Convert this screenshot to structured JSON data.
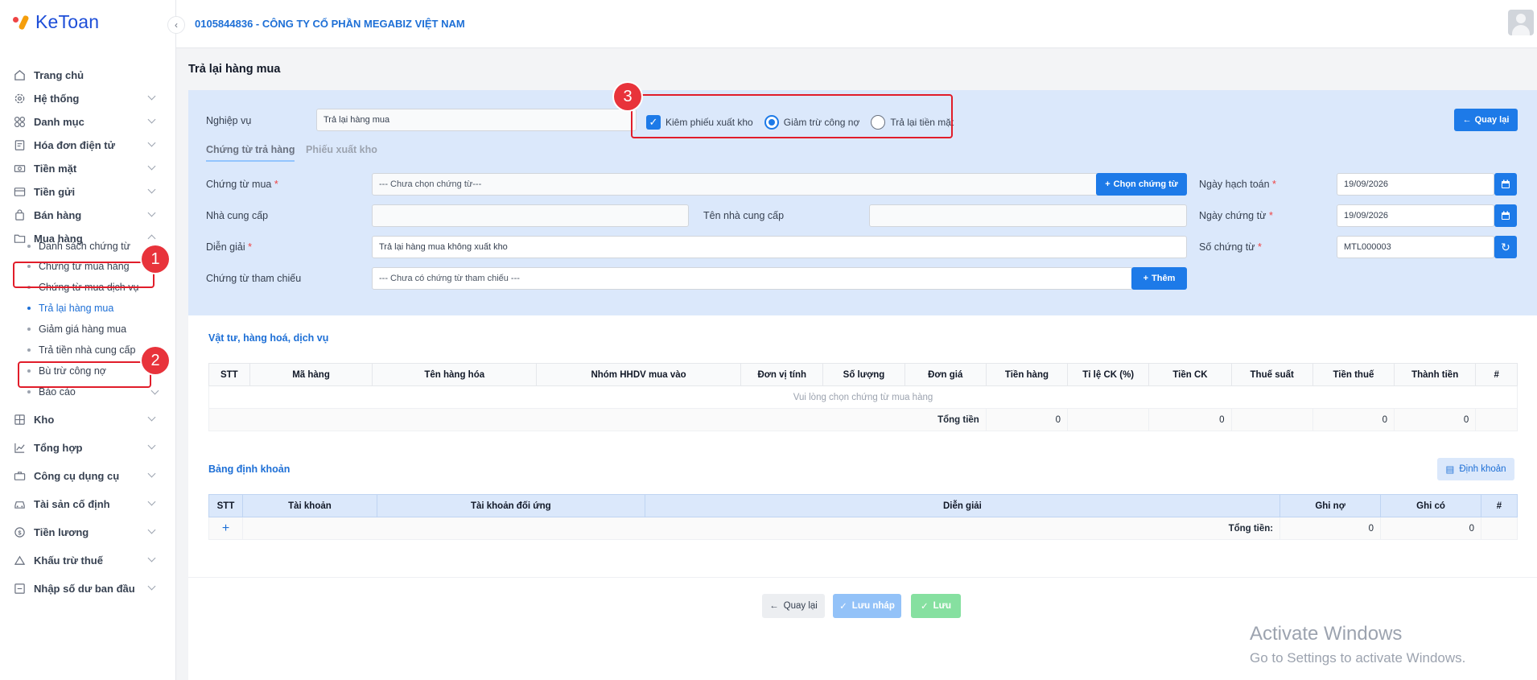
{
  "app": {
    "logo": "KeToan",
    "company": "0105844836 - CÔNG TY CỔ PHẦN MEGABIZ VIỆT NAM"
  },
  "sidebar": {
    "items": [
      {
        "label": "Trang chủ",
        "icon": "home-icon"
      },
      {
        "label": "Hệ thống",
        "icon": "gear-icon"
      },
      {
        "label": "Danh mục",
        "icon": "grid-icon"
      },
      {
        "label": "Hóa đơn điện tử",
        "icon": "invoice-icon"
      },
      {
        "label": "Tiền mặt",
        "icon": "cash-icon"
      },
      {
        "label": "Tiền gửi",
        "icon": "bank-icon"
      },
      {
        "label": "Bán hàng",
        "icon": "sales-icon"
      },
      {
        "label": "Mua hàng",
        "icon": "folder-icon"
      },
      {
        "label": "Kho",
        "icon": "warehouse-icon"
      },
      {
        "label": "Tổng hợp",
        "icon": "chart-icon"
      },
      {
        "label": "Công cụ dụng cụ",
        "icon": "tools-icon"
      },
      {
        "label": "Tài sản cố định",
        "icon": "car-icon"
      },
      {
        "label": "Tiền lương",
        "icon": "dollar-icon"
      },
      {
        "label": "Khấu trừ thuế",
        "icon": "tax-icon"
      },
      {
        "label": "Nhập số dư ban đầu",
        "icon": "import-icon"
      }
    ],
    "sub_items": [
      "Danh sách chứng từ",
      "Chứng từ mua hàng",
      "Chứng từ mua dịch vụ",
      "Trả lại hàng mua",
      "Giảm giá hàng mua",
      "Trả tiền nhà cung cấp",
      "Bù trừ công nợ",
      "Báo cáo"
    ]
  },
  "page": {
    "title": "Trả lại hàng mua"
  },
  "form": {
    "nghiep_vu_label": "Nghiệp vụ",
    "nghiep_vu_value": "Trả lại hàng mua",
    "check_kiem_phieu": "Kiêm phiếu xuất kho",
    "radio_giam_tru": "Giảm trừ công nợ",
    "radio_tra_tien": "Trả lại tiền mặt",
    "back_label": "Quay lại",
    "tabs": [
      "Chứng từ trả hàng",
      "Phiếu xuất kho"
    ],
    "chung_tu_mua_label": "Chứng từ mua",
    "chung_tu_mua_placeholder": "--- Chưa chọn chứng từ---",
    "chon_chung_tu_btn": "Chọn chứng từ",
    "nha_cung_cap_label": "Nhà cung cấp",
    "ten_ncc_label": "Tên nhà cung cấp",
    "dien_giai_label": "Diễn giải",
    "dien_giai_value": "Trả lại hàng mua không xuất kho",
    "tham_chieu_label": "Chứng từ tham chiếu",
    "tham_chieu_placeholder": "--- Chưa có chứng từ tham chiếu ---",
    "them_btn": "Thêm",
    "ngay_hach_toan_label": "Ngày hạch toán",
    "ngay_hach_toan_value": "19/09/2026",
    "ngay_chung_tu_label": "Ngày chứng từ",
    "ngay_chung_tu_value": "19/09/2026",
    "so_chung_tu_label": "Số chứng từ",
    "so_chung_tu_value": "MTL000003",
    "required_mark": "*"
  },
  "goods": {
    "title": "Vật tư, hàng hoá, dịch vụ",
    "columns": [
      "STT",
      "Mã hàng",
      "Tên hàng hóa",
      "Nhóm HHDV mua vào",
      "Đơn vị tính",
      "Số lượng",
      "Đơn giá",
      "Tiền hàng",
      "Tỉ lệ CK (%)",
      "Tiền CK",
      "Thuế suất",
      "Tiền thuế",
      "Thành tiền",
      "#"
    ],
    "empty_message": "Vui lòng chọn chứng từ mua hàng",
    "total_label": "Tổng tiền",
    "totals": {
      "tien_hang": "0",
      "tien_ck": "0",
      "tien_thue": "0",
      "thanh_tien": "0"
    }
  },
  "accounting": {
    "title": "Bảng định khoản",
    "dinh_khoan_btn": "Định khoản",
    "columns": [
      "STT",
      "Tài khoản",
      "Tài khoản đối ứng",
      "Diễn giải",
      "Ghi nợ",
      "Ghi có",
      "#"
    ],
    "add_symbol": "+",
    "total_label": "Tổng tiền:",
    "total_no": "0",
    "total_co": "0"
  },
  "footer": {
    "back": "Quay lại",
    "save_draft": "Lưu nháp",
    "save": "Lưu"
  },
  "annotations": {
    "b1": "1",
    "b2": "2",
    "b3": "3",
    "color": "#e11d2a"
  },
  "watermark": {
    "line1": "Activate Windows",
    "line2": "Go to Settings to activate Windows."
  }
}
